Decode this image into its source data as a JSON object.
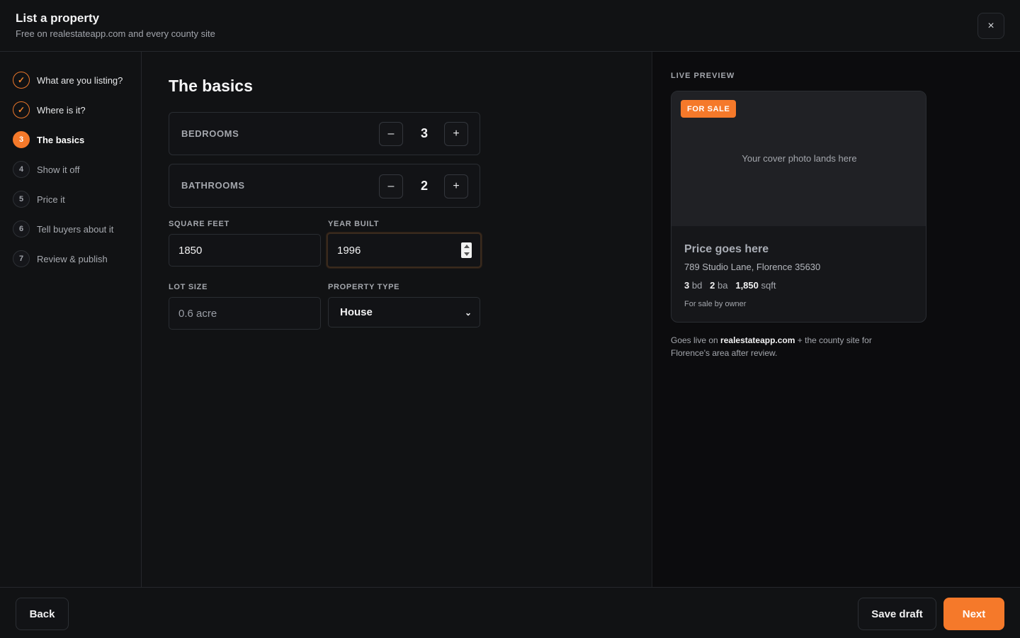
{
  "header": {
    "title": "List a property",
    "subtitle": "Free on realestateapp.com and every county site",
    "close_icon": "×"
  },
  "steps": [
    {
      "marker": "✓",
      "label": "What are you listing?",
      "state": "done"
    },
    {
      "marker": "✓",
      "label": "Where is it?",
      "state": "done"
    },
    {
      "marker": "3",
      "label": "The basics",
      "state": "active"
    },
    {
      "marker": "4",
      "label": "Show it off",
      "state": "upcoming"
    },
    {
      "marker": "5",
      "label": "Price it",
      "state": "upcoming"
    },
    {
      "marker": "6",
      "label": "Tell buyers about it",
      "state": "upcoming"
    },
    {
      "marker": "7",
      "label": "Review & publish",
      "state": "upcoming"
    }
  ],
  "main": {
    "title": "The basics",
    "bedrooms": {
      "label": "BEDROOMS",
      "value": "3",
      "minus": "–",
      "plus": "+"
    },
    "bathrooms": {
      "label": "BATHROOMS",
      "value": "2",
      "minus": "–",
      "plus": "+"
    },
    "square_feet": {
      "label": "SQUARE FEET",
      "value": "1850"
    },
    "year_built": {
      "label": "YEAR BUILT",
      "value": "1996"
    },
    "lot_size": {
      "label": "LOT SIZE",
      "placeholder": "0.6 acre"
    },
    "property_type": {
      "label": "PROPERTY TYPE",
      "value": "House",
      "chevron": "⌄"
    }
  },
  "preview": {
    "heading": "LIVE PREVIEW",
    "badge": "FOR SALE",
    "photo_placeholder": "Your cover photo lands here",
    "price": "Price goes here",
    "address": "789 Studio Lane, Florence 35630",
    "beds": "3",
    "beds_unit": "bd",
    "baths": "2",
    "baths_unit": "ba",
    "sqft": "1,850",
    "sqft_unit": "sqft",
    "owner": "For sale by owner",
    "note_prefix": "Goes live on",
    "note_site": "realestateapp.com",
    "note_suffix": "+ the county site for Florence's area after review."
  },
  "footer": {
    "back": "Back",
    "save_draft": "Save draft",
    "next": "Next"
  },
  "colors": {
    "accent": "#f5792a",
    "background": "#111214",
    "preview_background": "#0c0c0e"
  }
}
